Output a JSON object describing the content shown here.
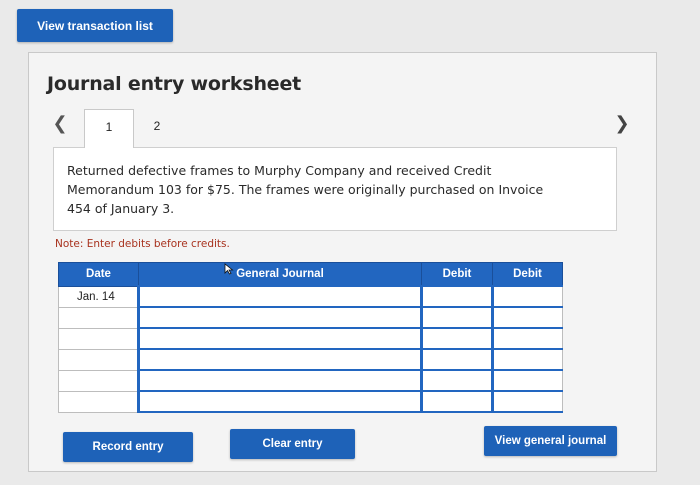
{
  "header": {
    "view_transactions_label": "View transaction list"
  },
  "worksheet": {
    "title": "Journal entry worksheet",
    "tabs": [
      {
        "label": "1",
        "active": true
      },
      {
        "label": "2",
        "active": false
      }
    ],
    "description": "Returned defective frames to Murphy Company and received Credit Memorandum 103 for $75. The frames were originally purchased on Invoice 454 of January 3.",
    "note": "Note: Enter debits before credits."
  },
  "journal_table": {
    "columns": [
      "Date",
      "General Journal",
      "Debit",
      "Debit"
    ],
    "rows": [
      {
        "date": "Jan. 14",
        "account": "",
        "debit": "",
        "credit": ""
      },
      {
        "date": "",
        "account": "",
        "debit": "",
        "credit": ""
      },
      {
        "date": "",
        "account": "",
        "debit": "",
        "credit": ""
      },
      {
        "date": "",
        "account": "",
        "debit": "",
        "credit": ""
      },
      {
        "date": "",
        "account": "",
        "debit": "",
        "credit": ""
      },
      {
        "date": "",
        "account": "",
        "debit": "",
        "credit": ""
      }
    ]
  },
  "buttons": {
    "record": "Record entry",
    "clear": "Clear entry",
    "view_journal": "View general journal"
  },
  "icons": {
    "prev": "chevron-left-icon",
    "next": "chevron-right-icon",
    "cursor": "mouse-pointer-icon"
  },
  "colors": {
    "primary_blue": "#1e62b8",
    "header_blue": "#2266c0",
    "note_red": "#a8321e"
  }
}
